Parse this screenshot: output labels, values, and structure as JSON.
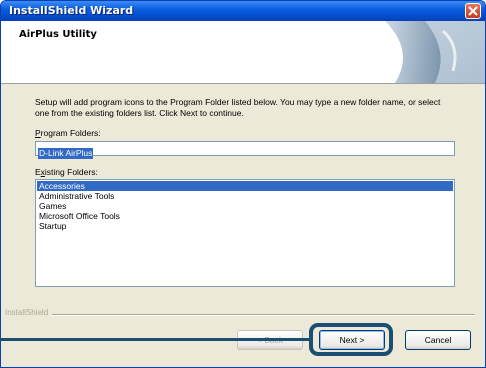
{
  "window": {
    "title": "InstallShield Wizard",
    "header_title": "AirPlus Utility"
  },
  "instructions": "Setup will add program icons to the Program Folder listed below.  You may type a new folder name, or select one from the existing folders list.  Click Next to continue.",
  "program_folder": {
    "label_accel": "P",
    "label_rest": "rogram Folders:",
    "value": "D-Link AirPlus"
  },
  "existing_folders": {
    "label_accel": "x",
    "label_pre": "E",
    "label_rest": "isting Folders:",
    "items": [
      "Accessories",
      "Administrative Tools",
      "Games",
      "Microsoft Office Tools",
      "Startup"
    ],
    "selected_index": 0
  },
  "footer": {
    "brand": "InstallShield",
    "back_label": "< Back",
    "next_label": "Next >",
    "cancel_label": "Cancel"
  },
  "colors": {
    "titlebar": "#0a5fe0",
    "selection": "#316ac5",
    "callout": "#1a4e73"
  },
  "icons": {
    "close": "close-x-icon",
    "header_art": "page-curl-graphic"
  }
}
